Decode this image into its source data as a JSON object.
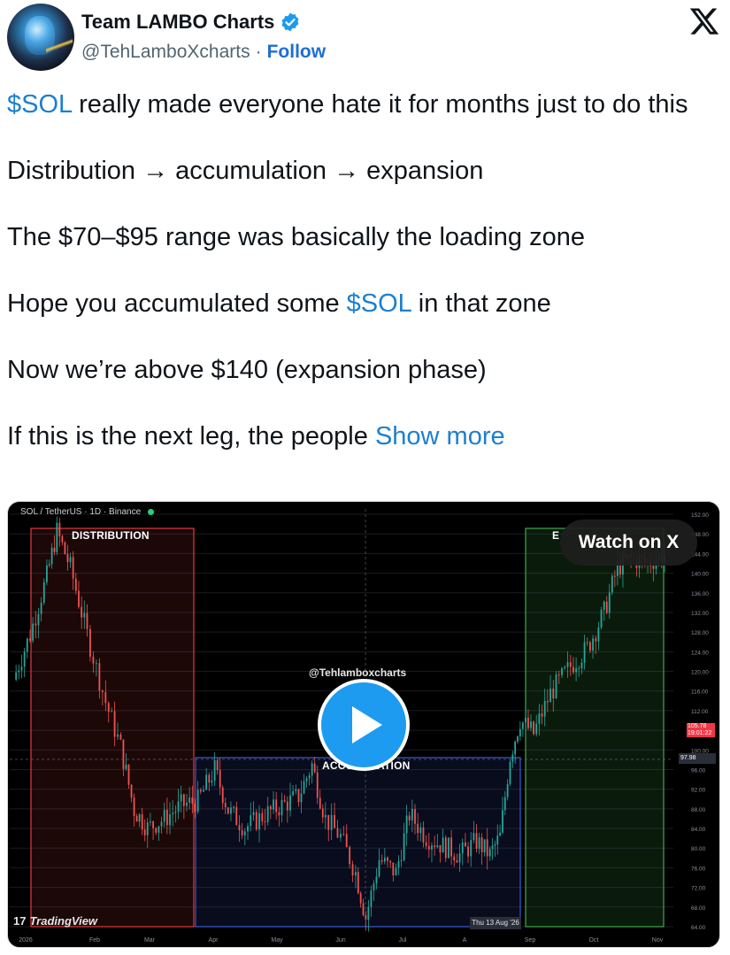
{
  "author": {
    "name": "Team LAMBO Charts",
    "handle": "@TehLamboXcharts",
    "separator": "·",
    "follow_label": "Follow"
  },
  "tweet": {
    "line1_cashtag": "$SOL",
    "line1_rest": " really made everyone hate it for months just to do this",
    "line2": "Distribution → accumulation → expansion",
    "line3": "The $70–$95 range was basically the loading zone",
    "line4_pre": "Hope you accumulated some ",
    "line4_cashtag": "$SOL",
    "line4_post": " in that zone",
    "line5": "Now we’re above $140 (expansion phase)",
    "line6": "If this is the next leg, the people ",
    "show_more": "Show more"
  },
  "media": {
    "symbol_title": "SOL / TetherUS · 1D · Binance",
    "watch_label": "Watch on X",
    "watermark": "@Tehlamboxcharts",
    "tradingview_label": "TradingView",
    "tv_mark": "17",
    "zones": {
      "distribution": "DISTRIBUTION",
      "accumulation": "ACCUMULATION",
      "expansion_partial": "E"
    },
    "price_tag_value": "105.78",
    "price_tag_sub": "19:01:22",
    "price_tag2": "97.98",
    "date_tag": "Thu 13 Aug '26"
  },
  "colors": {
    "accent": "#1d9bf0",
    "cashtag": "#1d7fd0",
    "distribution_zone": "#e23b3b",
    "accumulation_zone": "#3a5bd9",
    "expansion_zone": "#3fa84a",
    "up_candle": "#26a69a",
    "down_candle": "#ef5350"
  },
  "icons": {
    "verified": "verified-badge-icon",
    "x_logo": "x-logo-icon",
    "play": "play-icon"
  },
  "chart_data": {
    "type": "candlestick",
    "x_tick_labels": [
      "2026",
      "Feb",
      "Mar",
      "Apr",
      "May",
      "Jun",
      "Jul",
      "A",
      "Sep",
      "Oct",
      "Nov"
    ],
    "y_tick_labels": [
      "152.00",
      "148.00",
      "144.00",
      "140.00",
      "136.00",
      "132.00",
      "128.00",
      "124.00",
      "120.00",
      "116.00",
      "112.00",
      "108.00",
      "100.00",
      "96.00",
      "92.00",
      "88.00",
      "84.00",
      "80.00",
      "76.00",
      "72.00",
      "68.00",
      "64.00"
    ],
    "ylim": [
      60,
      153
    ],
    "zones": [
      {
        "label": "DISTRIBUTION",
        "x_start": "2026",
        "x_end": "Apr"
      },
      {
        "label": "ACCUMULATION",
        "x_start": "Apr",
        "x_end": "A"
      },
      {
        "label": "E",
        "x_start": "Sep",
        "x_end": "Nov"
      }
    ],
    "close_path": [
      {
        "x": 0,
        "y": 115
      },
      {
        "x": 10,
        "y": 125
      },
      {
        "x": 20,
        "y": 138
      },
      {
        "x": 26,
        "y": 148
      },
      {
        "x": 34,
        "y": 140
      },
      {
        "x": 44,
        "y": 125
      },
      {
        "x": 55,
        "y": 110
      },
      {
        "x": 64,
        "y": 100
      },
      {
        "x": 72,
        "y": 86
      },
      {
        "x": 80,
        "y": 82
      },
      {
        "x": 90,
        "y": 84
      },
      {
        "x": 100,
        "y": 87
      },
      {
        "x": 110,
        "y": 88
      },
      {
        "x": 120,
        "y": 95
      },
      {
        "x": 128,
        "y": 86
      },
      {
        "x": 138,
        "y": 82
      },
      {
        "x": 150,
        "y": 85
      },
      {
        "x": 160,
        "y": 87
      },
      {
        "x": 170,
        "y": 89
      },
      {
        "x": 178,
        "y": 96
      },
      {
        "x": 186,
        "y": 84
      },
      {
        "x": 195,
        "y": 80
      },
      {
        "x": 204,
        "y": 72
      },
      {
        "x": 210,
        "y": 62
      },
      {
        "x": 218,
        "y": 75
      },
      {
        "x": 228,
        "y": 72
      },
      {
        "x": 236,
        "y": 85
      },
      {
        "x": 246,
        "y": 80
      },
      {
        "x": 256,
        "y": 78
      },
      {
        "x": 266,
        "y": 76
      },
      {
        "x": 276,
        "y": 79
      },
      {
        "x": 284,
        "y": 76
      },
      {
        "x": 290,
        "y": 80
      },
      {
        "x": 296,
        "y": 98
      },
      {
        "x": 302,
        "y": 106
      },
      {
        "x": 310,
        "y": 103
      },
      {
        "x": 320,
        "y": 112
      },
      {
        "x": 332,
        "y": 118
      },
      {
        "x": 342,
        "y": 122
      },
      {
        "x": 352,
        "y": 130
      },
      {
        "x": 360,
        "y": 140
      },
      {
        "x": 368,
        "y": 142
      },
      {
        "x": 378,
        "y": 141
      },
      {
        "x": 388,
        "y": 143
      }
    ]
  }
}
